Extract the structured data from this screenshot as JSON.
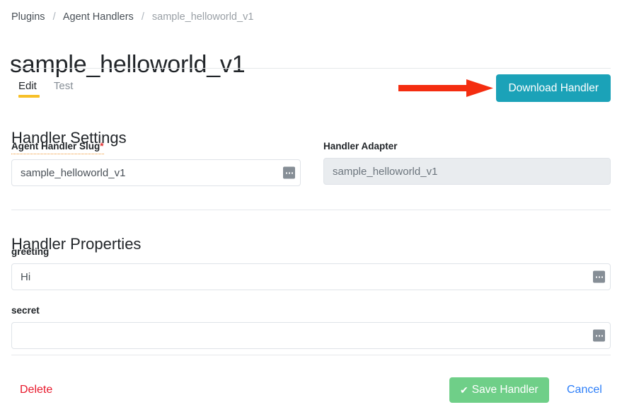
{
  "breadcrumb": {
    "items": [
      {
        "label": "Plugins",
        "muted": false
      },
      {
        "label": "Agent Handlers",
        "muted": false
      },
      {
        "label": "sample_helloworld_v1",
        "muted": true
      }
    ],
    "separator": "/"
  },
  "page": {
    "title": "sample_helloworld_v1"
  },
  "tabs": [
    {
      "label": "Edit",
      "active": true
    },
    {
      "label": "Test",
      "active": false
    }
  ],
  "toolbar": {
    "download_label": "Download Handler",
    "download_color": "#1ba2b8",
    "annotation_arrow_color": "#f42d10"
  },
  "sections": {
    "settings": {
      "heading": "Handler Settings",
      "slug": {
        "label": "Agent Handler Slug",
        "required_marker": "*",
        "value": "sample_helloworld_v1",
        "placeholder": ""
      },
      "adapter": {
        "label": "Handler Adapter",
        "value": "sample_helloworld_v1",
        "placeholder": "",
        "readonly": true
      }
    },
    "properties": {
      "heading": "Handler Properties",
      "greeting": {
        "label": "greeting",
        "value": "Hi",
        "placeholder": ""
      },
      "secret": {
        "label": "secret",
        "value": "",
        "placeholder": ""
      }
    }
  },
  "footer": {
    "delete_label": "Delete",
    "delete_color": "#e8192c",
    "save_label": "Save Handler",
    "save_icon": "check-icon",
    "save_color": "#6fcf88",
    "cancel_label": "Cancel",
    "cancel_color": "#2d7ff9"
  },
  "icons": {
    "ellipsis_handle": "ellipsis-handle-icon",
    "check": "✔"
  }
}
